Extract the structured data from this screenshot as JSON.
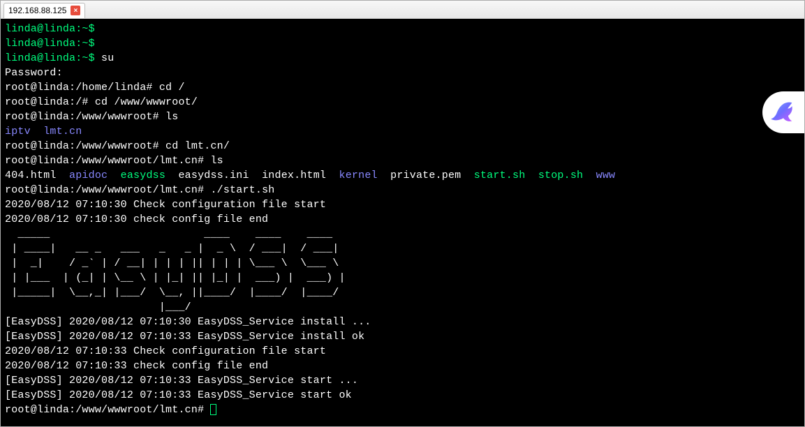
{
  "tab": {
    "label": "192.168.88.125",
    "close": "×"
  },
  "prompts": {
    "user_empty1": "linda@linda:~$",
    "user_empty2": "linda@linda:~$",
    "user_su": "linda@linda:~$ ",
    "cmd_su": "su",
    "password": "Password:",
    "root_home": "root@linda:/home/linda# ",
    "cmd_cd_root": "cd /",
    "root_slash": "root@linda:/# ",
    "cmd_cd_www": "cd /www/wwwroot/",
    "root_wwwroot": "root@linda:/www/wwwroot# ",
    "cmd_ls1": "ls",
    "ls1_iptv": "iptv",
    "ls1_lmt": "lmt.cn",
    "root_wwwroot2": "root@linda:/www/wwwroot# ",
    "cmd_cd_lmt": "cd lmt.cn/",
    "root_lmt": "root@linda:/www/wwwroot/lmt.cn# ",
    "cmd_ls2": "ls",
    "ls2": {
      "f404": "404.html",
      "apidoc": "apidoc",
      "easydss": "easydss",
      "easydssini": "easydss.ini",
      "indexhtml": "index.html",
      "kernel": "kernel",
      "private": "private.pem",
      "startsh": "start.sh",
      "stopsh": "stop.sh",
      "www": "www"
    },
    "root_lmt2": "root@linda:/www/wwwroot/lmt.cn# ",
    "cmd_start": "./start.sh",
    "out1": "2020/08/12 07:10:30 Check configuration file start",
    "out2": "2020/08/12 07:10:30 check config file end",
    "ascii1": "  _____                        ____    ____    ____",
    "ascii2": " | ____|   __ _   ___   _   _ |  _ \\  / ___|  / ___|",
    "ascii3": " |  _|    / _` | / __| | | | || | | | \\___ \\  \\___ \\",
    "ascii4": " | |___  | (_| | \\__ \\ | |_| || |_| |  ___) |  ___) |",
    "ascii5": " |_____|  \\__,_| |___/  \\__, ||____/  |____/  |____/",
    "ascii6": "                        |___/",
    "out3": "[EasyDSS] 2020/08/12 07:10:30 EasyDSS_Service install ...",
    "out4": "[EasyDSS] 2020/08/12 07:10:33 EasyDSS_Service install ok",
    "out5": "2020/08/12 07:10:33 Check configuration file start",
    "out6": "2020/08/12 07:10:33 check config file end",
    "out7": "[EasyDSS] 2020/08/12 07:10:33 EasyDSS_Service start ...",
    "out8": "[EasyDSS] 2020/08/12 07:10:33 EasyDSS_Service start ok",
    "root_lmt3": "root@linda:/www/wwwroot/lmt.cn# "
  }
}
